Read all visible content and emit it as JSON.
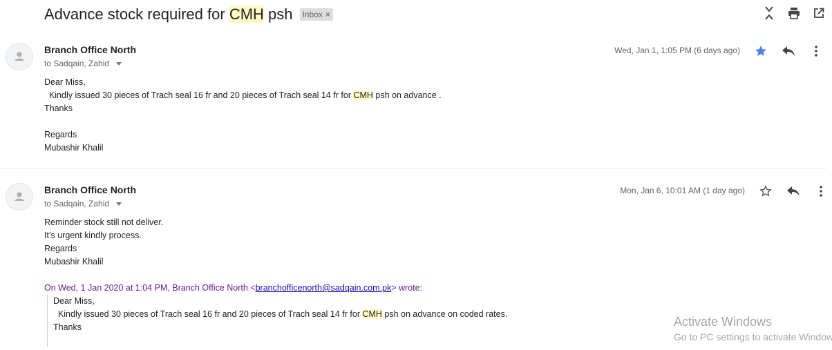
{
  "thread": {
    "subject_before": "Advance stock required for ",
    "subject_highlight": "CMH",
    "subject_after": " psh",
    "label": "Inbox",
    "label_close": "×"
  },
  "top_actions": {
    "icons": [
      "collapse-all-icon",
      "print-icon",
      "open-in-new-window-icon"
    ]
  },
  "messages": [
    {
      "sender": "Branch Office North",
      "recipients": "to Sadqain, Zahid",
      "date": "Wed, Jan 1, 1:05 PM (6 days ago)",
      "starred": true,
      "body": {
        "line1": "Dear Miss,",
        "line2_before": "  Kindly issued 30 pieces of Trach seal 16 fr and 20 pieces of Trach seal 14 fr for ",
        "line2_highlight": "CMH",
        "line2_after": " psh on advance .",
        "line3": "Thanks",
        "line4": "",
        "line5": "Regards",
        "line6": "Mubashir Khalil"
      }
    },
    {
      "sender": "Branch Office North",
      "recipients": "to Sadqain, Zahid",
      "date": "Mon, Jan 6, 10:01 AM (1 day ago)",
      "starred": false,
      "body": {
        "line1": "Reminder stock still not deliver.",
        "line2": "It’s urgent kindly process.",
        "line3": "Regards",
        "line4": "Mubashir Khalil",
        "quote_before": "On Wed, 1 Jan 2020 at 1:04 PM, Branch Office North <",
        "quote_email": "branchofficenorth@sadqain.com.pk",
        "quote_after": "> wrote:",
        "q_line1": "Dear Miss,",
        "q_line2_before": "  Kindly issued 30 pieces of Trach seal 16 fr and 20 pieces of Trach seal 14 fr for ",
        "q_line2_highlight": "CMH",
        "q_line2_after": " psh on advance on coded rates.",
        "q_line3": "Thanks"
      }
    }
  ],
  "watermark": {
    "title": "Activate Windows",
    "subtitle": "Go to PC settings to activate Windows."
  },
  "colors": {
    "highlight": "#fff9c4",
    "star_active": "#4a86e8",
    "quote_header": "#6a1b9a",
    "link": "#1a0dab"
  }
}
